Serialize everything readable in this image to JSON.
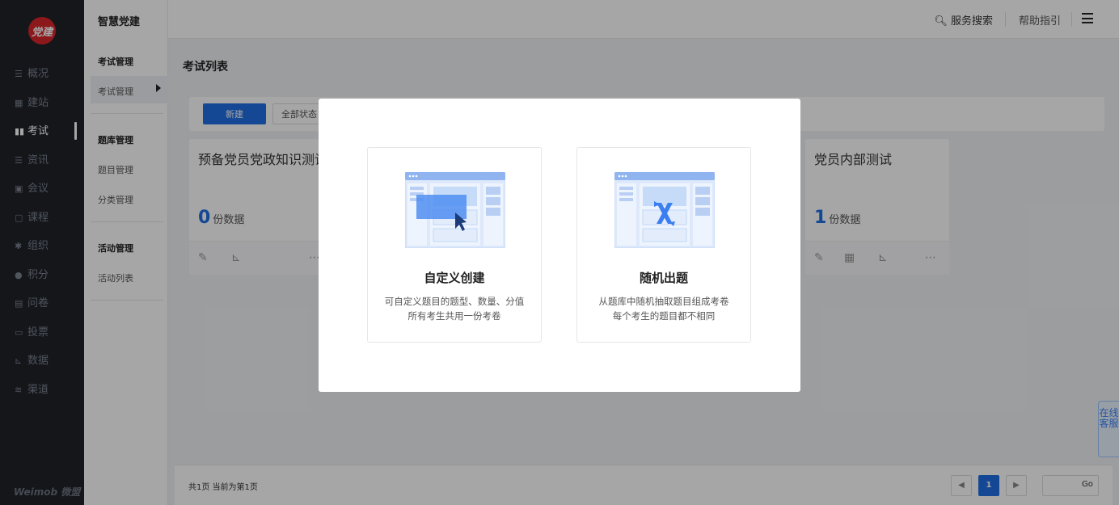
{
  "sidebar": {
    "logo_text": "党建",
    "items": [
      {
        "icon": "☰",
        "label": "概况"
      },
      {
        "icon": "▦",
        "label": "建站"
      },
      {
        "icon": "▮▮",
        "label": "考试"
      },
      {
        "icon": "☰",
        "label": "资讯"
      },
      {
        "icon": "▣",
        "label": "会议"
      },
      {
        "icon": "▢",
        "label": "课程"
      },
      {
        "icon": "✱",
        "label": "组织"
      },
      {
        "icon": "●",
        "label": "积分"
      },
      {
        "icon": "▤",
        "label": "问卷"
      },
      {
        "icon": "▭",
        "label": "投票"
      },
      {
        "icon": "⊾",
        "label": "数据"
      },
      {
        "icon": "≋",
        "label": "渠道"
      }
    ],
    "active_index": 2,
    "brand": "Weimob 微盟"
  },
  "subnav": {
    "title": "智慧党建",
    "groups": [
      {
        "label": "考试管理",
        "links": [
          "考试管理"
        ]
      },
      {
        "label": "题库管理",
        "links": [
          "题目管理",
          "分类管理"
        ]
      },
      {
        "label": "活动管理",
        "links": [
          "活动列表"
        ]
      }
    ]
  },
  "topbar": {
    "search_label": "服务搜索",
    "help_label": "帮助指引"
  },
  "main": {
    "page_title": "考试列表",
    "new_button": "新建",
    "filter_label": "全部状态",
    "cards": [
      {
        "name": "预备党员党政知识测试",
        "count": "0",
        "unit": "份数据"
      },
      {
        "name": "党员内部测试",
        "count": "1",
        "unit": "份数据"
      }
    ]
  },
  "pager": {
    "info": "共1页 当前为第1页",
    "prev": "◀",
    "current": "1",
    "next": "▶",
    "go": "Go"
  },
  "service": "在线客服",
  "modal": {
    "options": [
      {
        "title": "自定义创建",
        "desc_line1": "可自定义题目的题型、数量、分值",
        "desc_line2": "所有考生共用一份考卷"
      },
      {
        "title": "随机出题",
        "desc_line1": "从题库中随机抽取题目组成考卷",
        "desc_line2": "每个考生的题目都不相同"
      }
    ]
  },
  "colors": {
    "primary": "#1f6fe5",
    "sidebar_bg": "#1f2229",
    "logo_red": "#d7262a"
  }
}
